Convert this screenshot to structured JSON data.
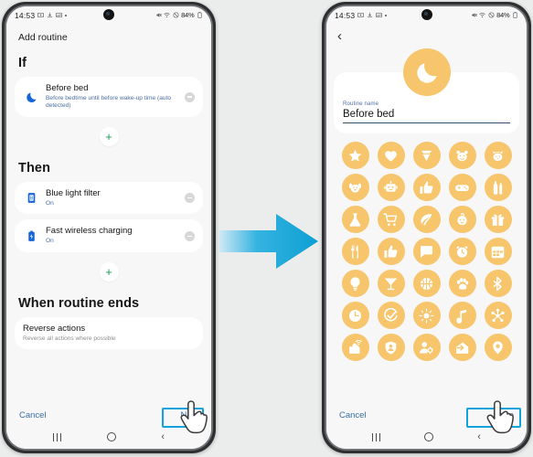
{
  "statusbar": {
    "time": "14:53",
    "battery_percent": "84%",
    "left_icons": [
      "screenshot-icon",
      "download-icon",
      "gallery-icon",
      "dot-icon"
    ],
    "right_icons": [
      "mute-icon",
      "wifi-icon",
      "alarm-icon",
      "battery-icon"
    ]
  },
  "left_phone": {
    "title": "Add routine",
    "sections": [
      {
        "heading": "If"
      },
      {
        "heading": "Then"
      },
      {
        "heading": "When routine ends"
      }
    ],
    "if_card": {
      "icon": "moon-icon",
      "title": "Before bed",
      "subtitle": "Before bedtime until before wake-up time (auto detected)",
      "remove": "remove-button"
    },
    "then_cards": [
      {
        "icon": "blue-light-filter-icon",
        "title": "Blue light filter",
        "subtitle": "On"
      },
      {
        "icon": "fast-wireless-charging-icon",
        "title": "Fast wireless charging",
        "subtitle": "On"
      }
    ],
    "end_card": {
      "title": "Reverse actions",
      "subtitle": "Reverse all actions where possible"
    },
    "add_label": "+",
    "footer": {
      "cancel": "Cancel",
      "primary": "Next"
    }
  },
  "right_phone": {
    "back": "‹",
    "hero_icon": "moon-icon",
    "name_field": {
      "label": "Routine name",
      "value": "Before bed",
      "placeholder": "Routine name"
    },
    "icon_grid": [
      "star-icon",
      "heart-icon",
      "diamond-icon",
      "bear-face-icon",
      "cat-face-icon",
      "dog-face-icon",
      "robot-icon",
      "thumbs-up-icon",
      "gamepad-icon",
      "bottles-icon",
      "flask-icon",
      "shopping-cart-icon",
      "leaf-icon",
      "baby-face-icon",
      "gift-icon",
      "cutlery-icon",
      "thumbs-up-filled-icon",
      "chat-bubble-icon",
      "alarm-clock-icon",
      "calendar-icon",
      "lightbulb-icon",
      "cocktail-icon",
      "basketball-icon",
      "paw-icon",
      "bluetooth-icon",
      "clock-icon",
      "check-circle-icon",
      "sun-icon",
      "music-note-icon",
      "molecule-icon",
      "smart-home-icon",
      "person-badge-icon",
      "person-settings-icon",
      "enter-home-icon",
      "location-pin-icon"
    ],
    "footer": {
      "cancel": "Cancel",
      "primary": "Done"
    }
  },
  "navbar": {
    "recents": "recents-button",
    "home": "home-button",
    "back": "‹"
  },
  "arrow": {
    "name": "flow-arrow"
  },
  "colors": {
    "accent_orange": "#f6c56c",
    "highlight_blue": "#12a3dc",
    "link_blue": "#3a6ea5",
    "arrow_blue": "#12a3dc"
  }
}
